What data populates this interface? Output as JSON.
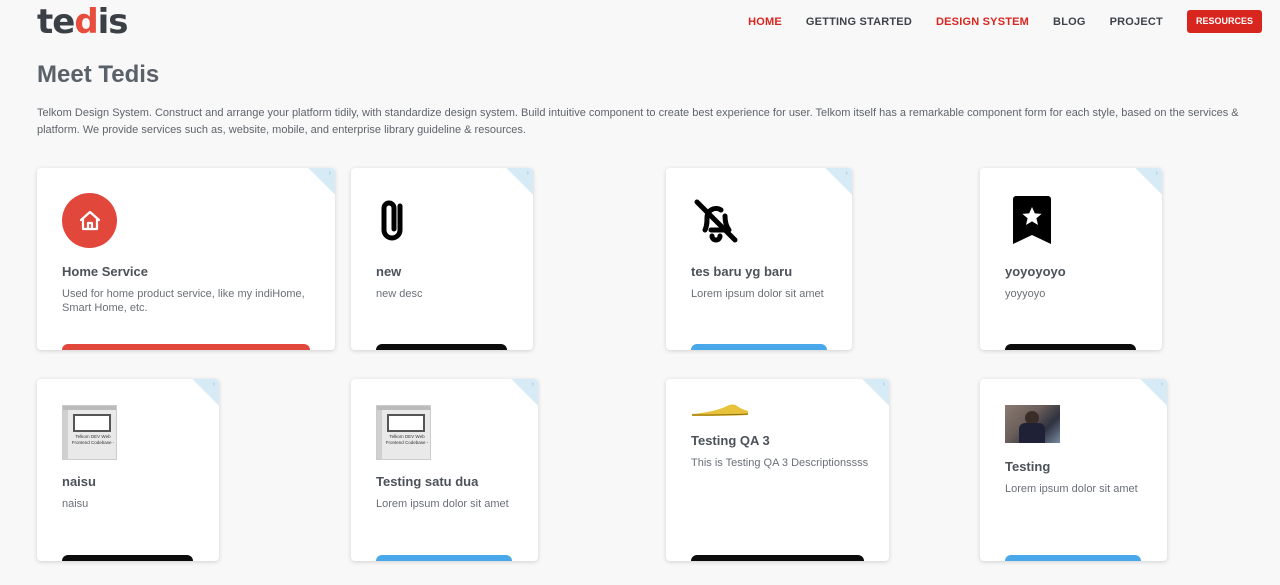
{
  "header": {
    "logo": {
      "part1": "te",
      "part2": "d",
      "part3": "is"
    },
    "nav": [
      {
        "label": "HOME",
        "active": true
      },
      {
        "label": "GETTING STARTED",
        "active": false
      },
      {
        "label": "DESIGN SYSTEM",
        "active": true
      },
      {
        "label": "BLOG",
        "active": false
      },
      {
        "label": "PROJECT",
        "active": false
      }
    ],
    "resources_label": "RESOURCES"
  },
  "intro": {
    "title": "Meet Tedis",
    "description": "Telkom Design System. Construct and arrange your platform tidily, with standardize design system. Build intuitive component to create best experience for user. Telkom itself has a remarkable component form for each style, based on the services & platform. We provide services such as, website, mobile, and enterprise library guideline & resources."
  },
  "cards": [
    {
      "title": "Home Service",
      "description": "Used for home product service, like my indiHome, Smart Home, etc.",
      "icon": "home-icon",
      "button_color": "#e2473c"
    },
    {
      "title": "new",
      "description": "new desc",
      "icon": "paperclip-icon",
      "button_color": "#0c0c0c"
    },
    {
      "title": "tes baru yg baru",
      "description": "Lorem ipsum dolor sit amet",
      "icon": "bell-off-icon",
      "button_color": "#48a8ea"
    },
    {
      "title": "yoyoyoyo",
      "description": "yoyyoyo",
      "icon": "bookmark-star-icon",
      "button_color": "#0c0c0c"
    },
    {
      "title": "naisu",
      "description": "naisu",
      "icon": "screenshot-thumbnail",
      "thumb_text": "Telkom DEV Web Frontend Codebase -",
      "button_color": "#0c0c0c"
    },
    {
      "title": "Testing satu dua",
      "description": "Lorem ipsum dolor sit amet",
      "icon": "screenshot-thumbnail",
      "thumb_text": "Telkom DEV Web Frontend Codebase -",
      "button_color": "#48a8ea"
    },
    {
      "title": "Testing QA 3",
      "description": "This is Testing QA 3 Descriptionssss",
      "icon": "shoe-image",
      "button_color": "#0c0c0c"
    },
    {
      "title": "Testing",
      "description": "Lorem ipsum dolor sit amet",
      "icon": "photo-image",
      "button_color": "#48a8ea"
    }
  ],
  "colors": {
    "brand_red": "#d8261f",
    "accent_blue": "#48a8ea",
    "fold_blue": "#d7ebf6"
  }
}
